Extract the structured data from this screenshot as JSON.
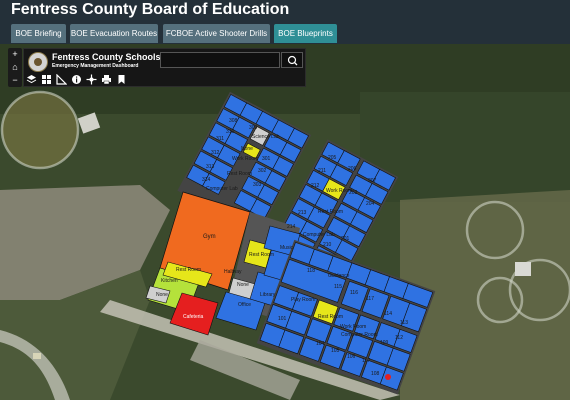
{
  "title": "Fentress County Board of Education",
  "tabs": [
    {
      "label": "BOE Briefing"
    },
    {
      "label": "BOE Evacuation Routes"
    },
    {
      "label": "FCBOE Active Shooter Drills"
    },
    {
      "label": "BOE Blueprints"
    }
  ],
  "zoom": {
    "in": "+",
    "home": "⌂",
    "out": "−"
  },
  "dashboard": {
    "name": "Fentress County Schools",
    "subtitle": "Emergency Management Dashboard",
    "search_placeholder": ""
  },
  "toolbar_icons": [
    "layers-icon",
    "basemap-icon",
    "measure-icon",
    "info-icon",
    "locate-icon",
    "print-icon",
    "bookmark-icon"
  ],
  "map": {
    "rooms": {
      "gym": "Gym",
      "kitchen": "Kitchen",
      "cafeteria": "Cafeteria",
      "rest_room_1": "Rest Room",
      "rest_room_2": "Rest Room",
      "rest_room_3": "Rest Room",
      "rest_room_4": "Rest Room",
      "rest_room_5": "Rest Room",
      "none_1": "None",
      "none_2": "None",
      "none_3": "None",
      "office": "Office",
      "library": "Library",
      "hallway": "Hallway",
      "music": "Music",
      "play_room": "Play Room",
      "work_room_1": "Work Room",
      "work_room_2": "Work Room",
      "work_room_3": "Work Room",
      "science_lab": "Science Lab",
      "computer_lab_1": "Computer Lab",
      "computer_lab_2": "Computer Lab",
      "computer_lab_3": "Computer Room",
      "guidance": "Guidance",
      "numbers": [
        "308",
        "309",
        "311",
        "310",
        "312",
        "313",
        "314",
        "301",
        "302",
        "303",
        "205",
        "206",
        "207",
        "203",
        "204",
        "211",
        "212",
        "213",
        "214",
        "210",
        "201",
        "118",
        "115",
        "116",
        "117",
        "114",
        "113",
        "101",
        "104",
        "105",
        "106",
        "107",
        "108",
        "109",
        "112"
      ]
    }
  },
  "colors": {
    "title_bg": "#243039",
    "tab": "#55707d",
    "tab_active": "#2f8f96",
    "classroom": "#2f72e2",
    "gym": "#f06a1f",
    "restroom": "#e6e61a",
    "kitchen": "#b5e23b",
    "cafeteria": "#e51f1f",
    "none": "#cfcfcf"
  }
}
